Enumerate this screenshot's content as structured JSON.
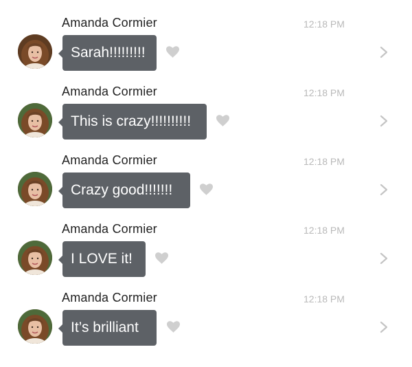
{
  "colors": {
    "bubble": "#5d6166",
    "time": "#b9b9b9",
    "heart": "#cfcfcf",
    "chevron": "#c4c4c4"
  },
  "messages": [
    {
      "sender": "Amanda Cormier",
      "time": "12:18 PM",
      "text": "Sarah!!!!!!!!!",
      "icon": "heart-icon"
    },
    {
      "sender": "Amanda Cormier",
      "time": "12:18 PM",
      "text": "This is crazy!!!!!!!!!!",
      "icon": "heart-icon"
    },
    {
      "sender": "Amanda Cormier",
      "time": "12:18 PM",
      "text": "Crazy good!!!!!!!",
      "icon": "heart-icon"
    },
    {
      "sender": "Amanda Cormier",
      "time": "12:18 PM",
      "text": "I LOVE it!",
      "icon": "heart-icon"
    },
    {
      "sender": "Amanda Cormier",
      "time": "12:18 PM",
      "text": "It’s brilliant",
      "icon": "heart-icon"
    }
  ]
}
